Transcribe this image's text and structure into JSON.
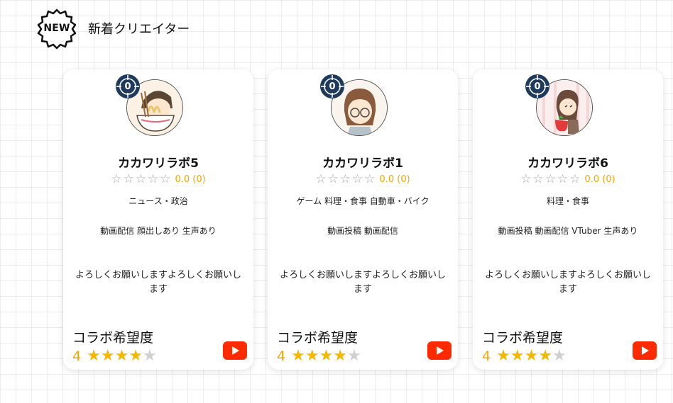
{
  "header": {
    "badge_text": "NEW",
    "title": "新着クリエイター"
  },
  "colors": {
    "accent_star": "#f5b800",
    "rating_text": "#f5a500",
    "rank_badge": "#1e3a5c",
    "youtube_red": "#ff2a00"
  },
  "cards": [
    {
      "rank": "0",
      "avatar_icon": "avatar-ramen-icon",
      "name": "カカワリラボ5",
      "rating_text": "0.0 (0)",
      "genres": "ニュース・政治",
      "activities": "動画配信 顔出しあり 生声あり",
      "bio": "よろしくお願いしますよろしくお願いします",
      "collab_label": "コラボ希望度",
      "collab_score": "4",
      "collab_level": 4,
      "link_icon": "youtube-icon"
    },
    {
      "rank": "0",
      "avatar_icon": "avatar-glasses-icon",
      "name": "カカワリラボ1",
      "rating_text": "0.0 (0)",
      "genres": "ゲーム 料理・食事 自動車・バイク",
      "activities": "動画投稿 動画配信",
      "bio": "よろしくお願いしますよろしくお願いします",
      "collab_label": "コラボ希望度",
      "collab_score": "4",
      "collab_level": 4,
      "link_icon": "youtube-icon"
    },
    {
      "rank": "0",
      "avatar_icon": "avatar-strawberry-icon",
      "name": "カカワリラボ6",
      "rating_text": "0.0 (0)",
      "genres": "料理・食事",
      "activities": "動画投稿 動画配信 VTuber 生声あり",
      "bio": "よろしくお願いしますよろしくお願いします",
      "collab_label": "コラボ希望度",
      "collab_score": "4",
      "collab_level": 4,
      "link_icon": "youtube-icon"
    }
  ]
}
